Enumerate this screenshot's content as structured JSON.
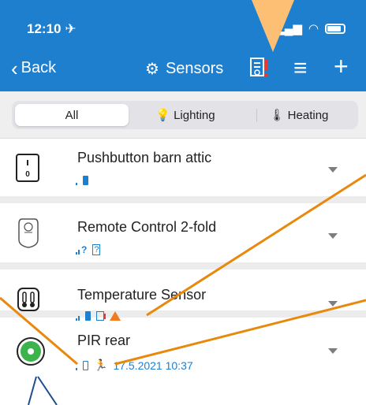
{
  "status": {
    "time": "12:10 ✈",
    "signal_icon": "signal-icon",
    "wifi_icon": "wifi-icon"
  },
  "nav": {
    "back_label": "Back",
    "title": "Sensors",
    "gear_icon": "⚙",
    "menu_icon": "≡",
    "add_icon": "+"
  },
  "tabs": [
    {
      "label": "All",
      "icon": ""
    },
    {
      "label": "Lighting",
      "icon": "💡"
    },
    {
      "label": "Heating",
      "icon": "🌡"
    }
  ],
  "devices": [
    {
      "name": "Pushbutton barn attic",
      "icon_text": "I\n0"
    },
    {
      "name": "Remote Control 2-fold",
      "icon_text": ""
    },
    {
      "name": "Temperature Sensor",
      "icon_text": ""
    },
    {
      "name": "PIR rear",
      "timestamp": "17.5.2021 10:37",
      "icon_text": ""
    }
  ],
  "colors": {
    "header": "#1f7fcf",
    "accent": "#1f7fcf",
    "warning": "#f07c1e",
    "callout": "#fcbf74",
    "annotation": "#e8880c"
  }
}
